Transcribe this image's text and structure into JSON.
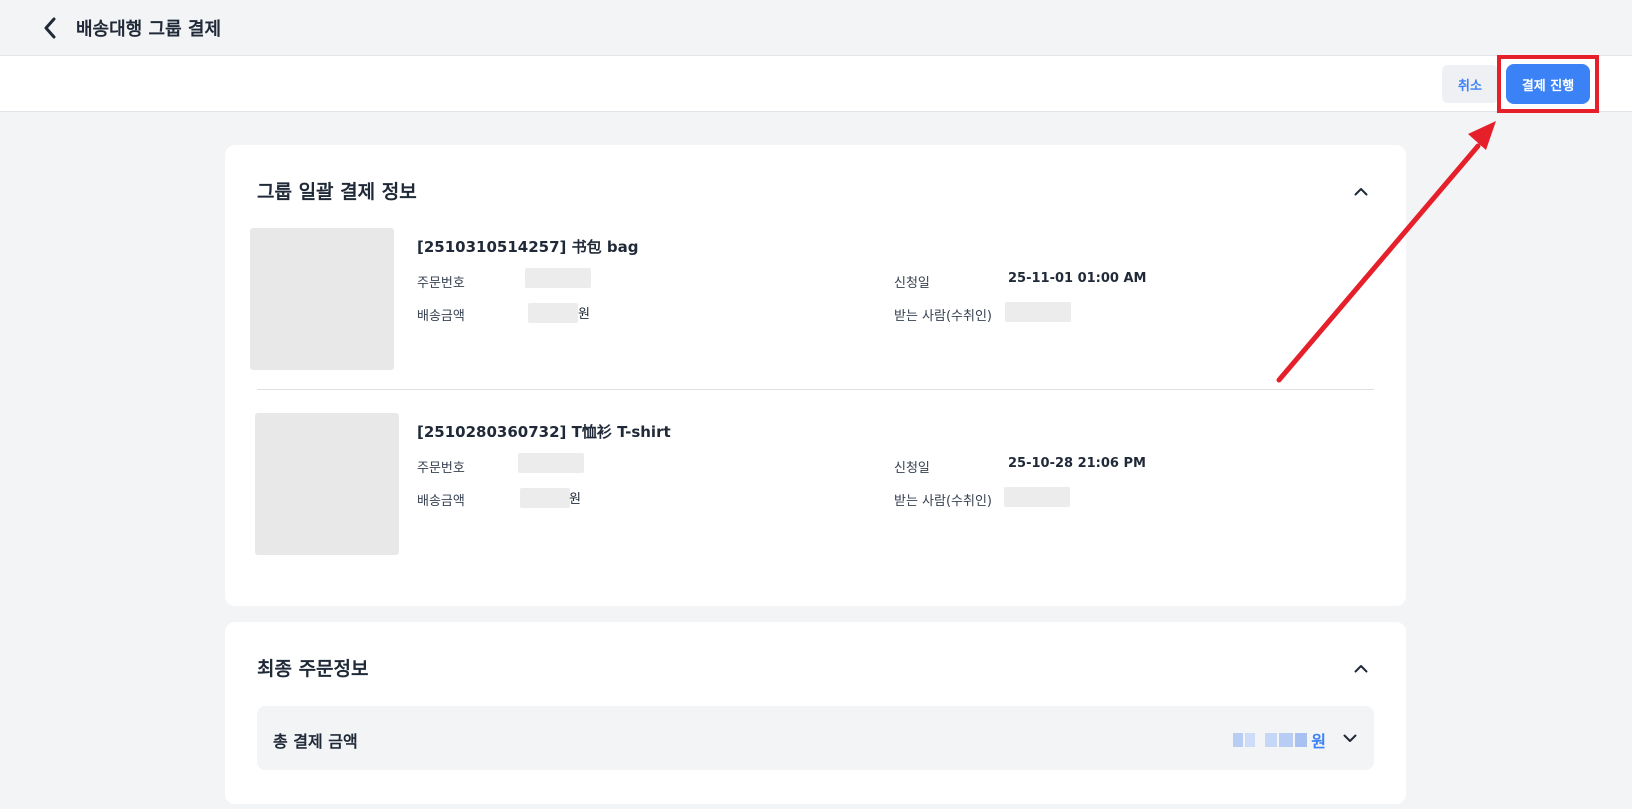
{
  "header": {
    "title": "배송대행 그룹 결제"
  },
  "actions": {
    "cancel_label": "취소",
    "pay_label": "결제 진행"
  },
  "group_section": {
    "title": "그룹 일괄 결제 정보",
    "items": [
      {
        "title": "[2510310514257] 书包 bag",
        "order_no_label": "주문번호",
        "shipping_fee_label": "배송금액",
        "currency_unit": "원",
        "request_date_label": "신청일",
        "request_date": "25-11-01 01:00 AM",
        "recipient_label": "받는 사람(수취인)"
      },
      {
        "title": "[2510280360732] T恤衫 T-shirt",
        "order_no_label": "주문번호",
        "shipping_fee_label": "배송금액",
        "currency_unit": "원",
        "request_date_label": "신청일",
        "request_date": "25-10-28 21:06 PM",
        "recipient_label": "받는 사람(수취인)"
      }
    ]
  },
  "final_section": {
    "title": "최종 주문정보",
    "total_label": "총 결제 금액",
    "total_unit": "원"
  },
  "colors": {
    "accent": "#3b82f6",
    "highlight": "#e5202a"
  }
}
